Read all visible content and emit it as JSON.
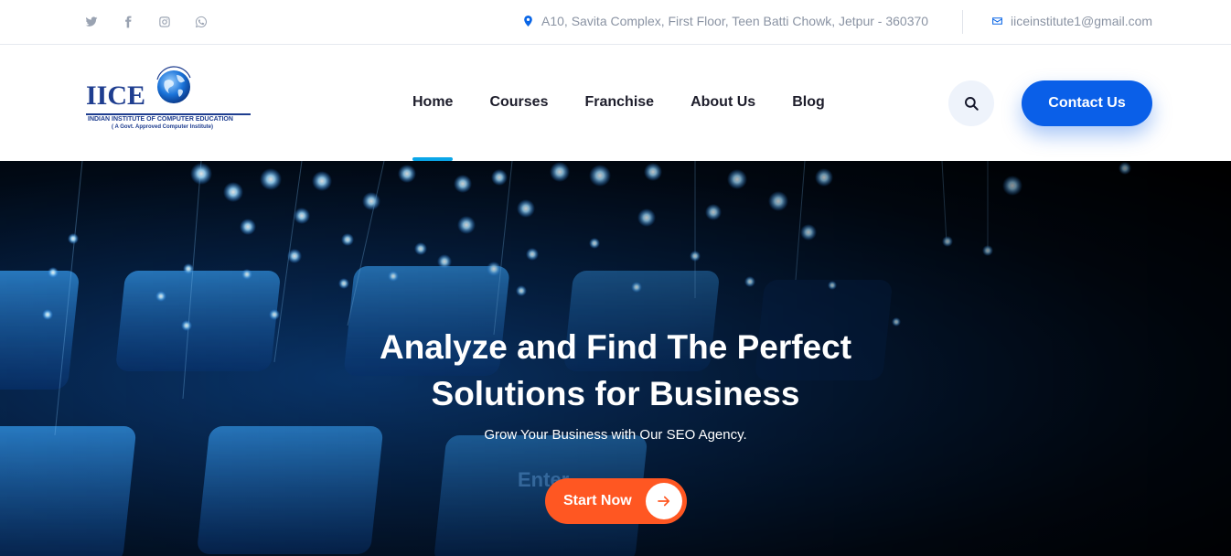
{
  "topbar": {
    "social_icons": [
      "twitter-icon",
      "facebook-icon",
      "instagram-icon",
      "whatsapp-icon"
    ],
    "address": "A10, Savita Complex, First Floor, Teen Batti Chowk, Jetpur - 360370",
    "email": "iiceinstitute1@gmail.com"
  },
  "logo": {
    "text": "IICE",
    "line1": "INDIAN INSTITUTE OF COMPUTER EDUCATION",
    "line2": "( A Govt. Approved Computer Institute)"
  },
  "nav": {
    "items": [
      {
        "label": "Home",
        "active": true
      },
      {
        "label": "Courses",
        "active": false
      },
      {
        "label": "Franchise",
        "active": false
      },
      {
        "label": "About Us",
        "active": false
      },
      {
        "label": "Blog",
        "active": false
      }
    ],
    "contact_label": "Contact Us"
  },
  "hero": {
    "title_line1": "Analyze and Find The Perfect",
    "title_line2": "Solutions for Business",
    "tagline": "Grow Your Business with Our SEO Agency.",
    "cta_label": "Start Now"
  },
  "colors": {
    "primary": "#0a5fe8",
    "accent": "#ff5722",
    "active_underline": "#0aa6e8",
    "muted_text": "#8a93a3"
  }
}
